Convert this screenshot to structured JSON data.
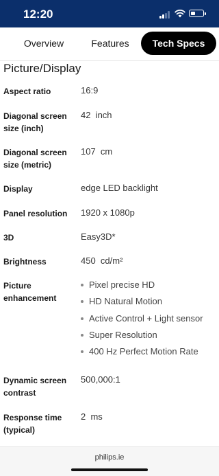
{
  "status_bar": {
    "time": "12:20"
  },
  "tabs": [
    {
      "label": "Overview",
      "active": false
    },
    {
      "label": "Features",
      "active": false
    },
    {
      "label": "Tech Specs",
      "active": true
    }
  ],
  "section": {
    "title": "Picture/Display"
  },
  "specs": [
    {
      "label": "Aspect ratio",
      "value": "16:9"
    },
    {
      "label": "Diagonal screen size (inch)",
      "value": "42  inch"
    },
    {
      "label": "Diagonal screen size (metric)",
      "value": "107  cm"
    },
    {
      "label": "Display",
      "value": "edge LED backlight"
    },
    {
      "label": "Panel resolution",
      "value": "1920 x 1080p"
    },
    {
      "label": "3D",
      "value": "Easy3D*"
    },
    {
      "label": "Brightness",
      "value": "450  cd/m²"
    },
    {
      "label": "Picture enhancement",
      "bullets": [
        "Pixel precise HD",
        "HD Natural Motion",
        "Active Control + Light sensor",
        "Super Resolution",
        "400 Hz Perfect Motion Rate"
      ]
    },
    {
      "label": "Dynamic screen contrast",
      "value": "500,000:1"
    },
    {
      "label": "Response time (typical)",
      "value": "2  ms"
    }
  ],
  "browser": {
    "url": "philips.ie"
  },
  "colors": {
    "status_bar_bg": "#0b2f6b",
    "active_tab_bg": "#000000"
  }
}
